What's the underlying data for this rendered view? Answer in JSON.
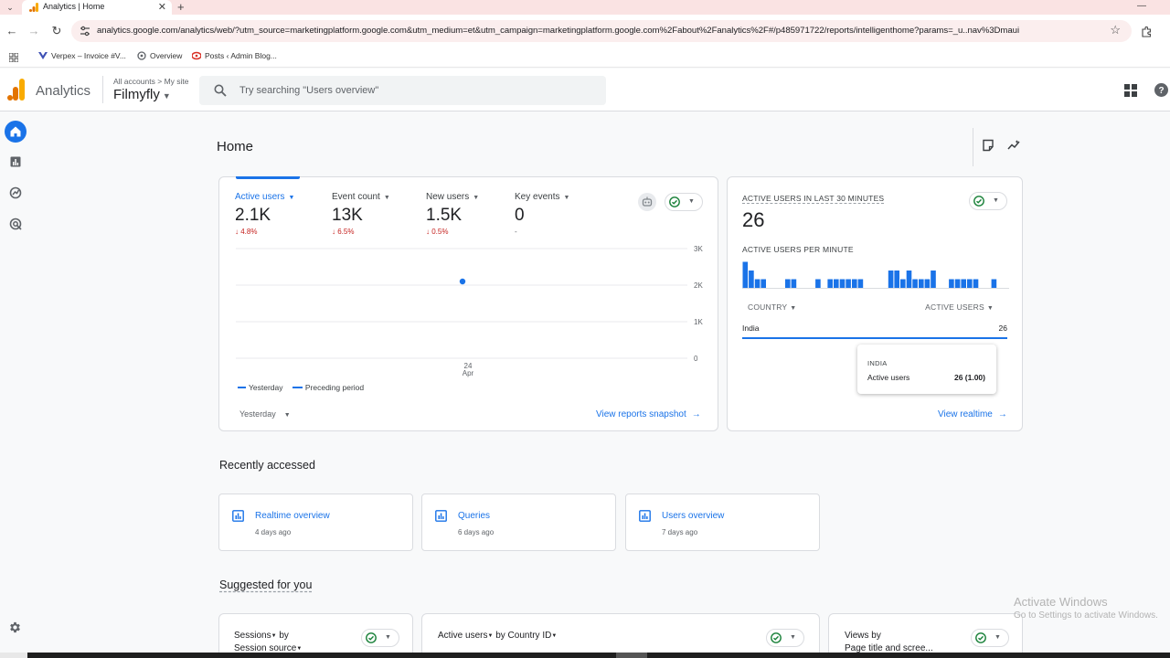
{
  "browser": {
    "tab_title": "Analytics | Home",
    "url": "analytics.google.com/analytics/web/?utm_source=marketingplatform.google.com&utm_medium=et&utm_campaign=marketingplatform.google.com%2Fabout%2Fanalytics%2F#/p485971722/reports/intelligenthome?params=_u..nav%3Dmaui",
    "bookmarks": [
      "Verpex – Invoice #V...",
      "Overview",
      "Posts ‹ Admin Blog..."
    ]
  },
  "header": {
    "product": "Analytics",
    "breadcrumb_all": "All accounts",
    "breadcrumb_site": "My site",
    "property": "Filmyfly",
    "search_placeholder": "Try searching \"Users overview\""
  },
  "page": {
    "title": "Home"
  },
  "metrics": [
    {
      "label": "Active users",
      "value": "2.1K",
      "change": "4.8%",
      "direction": "down"
    },
    {
      "label": "Event count",
      "value": "13K",
      "change": "6.5%",
      "direction": "down"
    },
    {
      "label": "New users",
      "value": "1.5K",
      "change": "0.5%",
      "direction": "down"
    },
    {
      "label": "Key events",
      "value": "0",
      "change": "-",
      "direction": "none"
    }
  ],
  "chart_data": {
    "type": "line",
    "series": [
      {
        "name": "Yesterday",
        "x": [
          "24 Apr"
        ],
        "values": [
          2100
        ]
      },
      {
        "name": "Preceding period",
        "x": [],
        "values": []
      }
    ],
    "y_ticks": [
      "3K",
      "2K",
      "1K",
      "0"
    ],
    "x_tick": {
      "day": "24",
      "month": "Apr"
    },
    "ylim": [
      0,
      3000
    ],
    "grid": true,
    "legend_position": "bottom-left"
  },
  "chart_footer": {
    "legend_yesterday": "Yesterday",
    "legend_preceding": "Preceding period",
    "date_range": "Yesterday",
    "link": "View reports snapshot"
  },
  "realtime": {
    "title": "ACTIVE USERS IN LAST 30 MINUTES",
    "value": "26",
    "per_minute_label": "ACTIVE USERS PER MINUTE",
    "per_minute": [
      3,
      2,
      1,
      1,
      0,
      0,
      0,
      1,
      1,
      0,
      0,
      0,
      1,
      0,
      1,
      1,
      1,
      1,
      1,
      1,
      0,
      0,
      0,
      0,
      2,
      2,
      1,
      2,
      1,
      1,
      1,
      2,
      0,
      0,
      1,
      1,
      1,
      1,
      1,
      0,
      0,
      1,
      0,
      0
    ],
    "col_country": "COUNTRY",
    "col_users": "ACTIVE USERS",
    "rows": [
      {
        "country": "India",
        "users": "26"
      }
    ],
    "tooltip": {
      "country": "INDIA",
      "label": "Active users",
      "value": "26 (1.00)"
    },
    "link": "View realtime"
  },
  "recent": {
    "title": "Recently accessed",
    "items": [
      {
        "name": "Realtime overview",
        "time": "4 days ago"
      },
      {
        "name": "Queries",
        "time": "6 days ago"
      },
      {
        "name": "Users overview",
        "time": "7 days ago"
      }
    ]
  },
  "suggested": {
    "title": "Suggested for you",
    "cards": [
      {
        "metric": "Sessions",
        "by": "by",
        "dimension": "Session source"
      },
      {
        "metric": "Active users",
        "by": "by",
        "dimension": "Country ID"
      },
      {
        "metric": "Views",
        "by": "by",
        "dimension": "Page title and scree..."
      }
    ]
  },
  "watermark": {
    "line1": "Activate Windows",
    "line2": "Go to Settings to activate Windows."
  },
  "colors": {
    "accent": "#1a73e8",
    "negative": "#c5221f",
    "positive": "#188038",
    "tab_strip": "#fae3e3"
  }
}
